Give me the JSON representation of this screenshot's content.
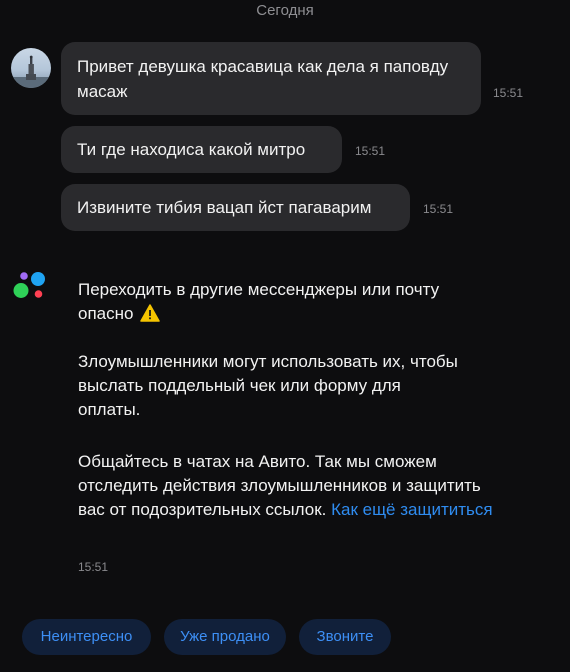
{
  "date_separator": "Сегодня",
  "messages": [
    {
      "text": "Привет девушка красавица как дела я паповду масаж",
      "time": "15:51"
    },
    {
      "text": "Ти где находиса какой митро",
      "time": "15:51"
    },
    {
      "text": "Извините тибия вацап йст пагаварим",
      "time": "15:51"
    }
  ],
  "system_message": {
    "title": "Переходить в другие мессенджеры или почту опасно",
    "warning_icon": "warning-icon",
    "paragraph_1": "Злоумышленники могут использовать их, чтобы выслать поддельный чек или форму для оплаты.",
    "paragraph_2": "Общайтесь в чатах на Авито. Так мы сможем отследить действия злоумышленников и защитить вас от подозрительных ссылок.",
    "link_text": "Как ещё защититься",
    "time": "15:51"
  },
  "quick_replies": [
    "Неинтересно",
    "Уже продано",
    "Звоните"
  ],
  "colors": {
    "background": "#0d0d0f",
    "bubble": "#2a2a2d",
    "link": "#2f8cf0",
    "quick_reply_bg": "#11203a",
    "quick_reply_text": "#3d8ff5",
    "logo_green": "#2fd158",
    "logo_blue": "#1fa3f2",
    "logo_red": "#ff4053",
    "logo_purple": "#a06bf5"
  }
}
